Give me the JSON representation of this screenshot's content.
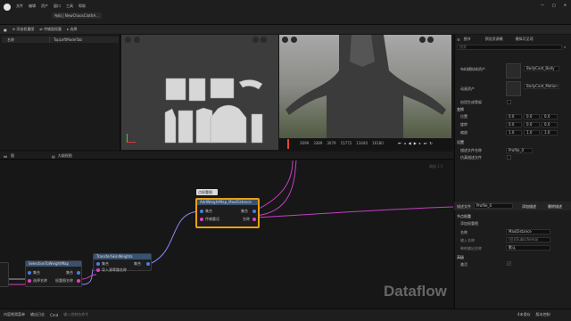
{
  "menu": {
    "items": [
      "文件",
      "编辑",
      "资产",
      "窗口",
      "工具",
      "帮助"
    ]
  },
  "tab": {
    "label": "布料 | NewChaosClothA..."
  },
  "toolbar": {
    "add_weight_map": "添加权重图",
    "transfer_weight_map": "传输面权重",
    "select": "选择"
  },
  "left_panel": {
    "col1": "名称",
    "col2": "TopLeftModeTab"
  },
  "viewport": {
    "frames": [
      "2699",
      "3389",
      "3079",
      "15772",
      "13440",
      "16180"
    ]
  },
  "graph": {
    "tab_label": "图",
    "tab2_label": "大纲视图",
    "zoom": "缩放 1:1",
    "watermark": "Dataflow",
    "comment": "点权重图"
  },
  "nodes": {
    "max_distance": {
      "title": "AddWeightMap_MaxDistance",
      "pin_in1": "集合",
      "pin_in2": "传输重设",
      "pin_out1": "集合",
      "pin_out2": "名称"
    },
    "selection": {
      "title": "SelectionToWeightMap",
      "pin_in1": "集合",
      "pin_in2": "选择名称",
      "pin_out1": "集合",
      "pin_out2": "权重图名称"
    },
    "transfer": {
      "title": "TransferSkinWeights",
      "pin_in1": "集合",
      "pin_in2": "导入源骨骼名称",
      "pin_out1": "集合"
    }
  },
  "right_panel": {
    "tab_details": "细节",
    "tab_preset": "预设资源模",
    "tab_cloth": "模拟可见项",
    "search_placeholder": "搜索",
    "asset_label1": "布料模拟体资产",
    "asset_name1": "BodyCoat_Body",
    "asset_label2": "动画资产",
    "asset_name2": "BodyCoat_Motion",
    "enable_label": "启用生成骨架",
    "transform_section": "变换",
    "location_label": "位置",
    "rotation_label": "旋转",
    "scale_label": "缩放",
    "loc": [
      "0.0",
      "0.0",
      "0.0"
    ],
    "rot": [
      "0.0",
      "0.0",
      "0.0"
    ],
    "scl": [
      "1.0",
      "1.0",
      "1.0"
    ],
    "settings_section": "设置",
    "desc_label": "描述文件名称",
    "desc_value": "Profile_0",
    "sim_label": "仿真描述文件",
    "profile_label": "描述文件",
    "profile_value": "Profile_0",
    "add_desc_btn": "添加描述",
    "remove_desc_btn": "删除描述",
    "weight_section": "节点权重",
    "weight_sub": "添加权重图",
    "name_label": "名称",
    "name_value": "MaxDistance",
    "input_label": "输入名称",
    "input_value": "(位)(Subschema)",
    "type_label": "映射输出名称",
    "type_value": "默认",
    "advanced_section": "高级",
    "output_label": "激活"
  },
  "statusbar": {
    "items": [
      "内容侧滑菜单",
      "输出日志",
      "Cmd",
      "输入控制台命令"
    ],
    "right": "4未保存",
    "source": "版本控制"
  },
  "colors": {
    "accent": "#e8a013",
    "pin_pink": "#e040c0",
    "wire_purple": "#c63fc6",
    "pin_blue": "#4a7de0"
  }
}
